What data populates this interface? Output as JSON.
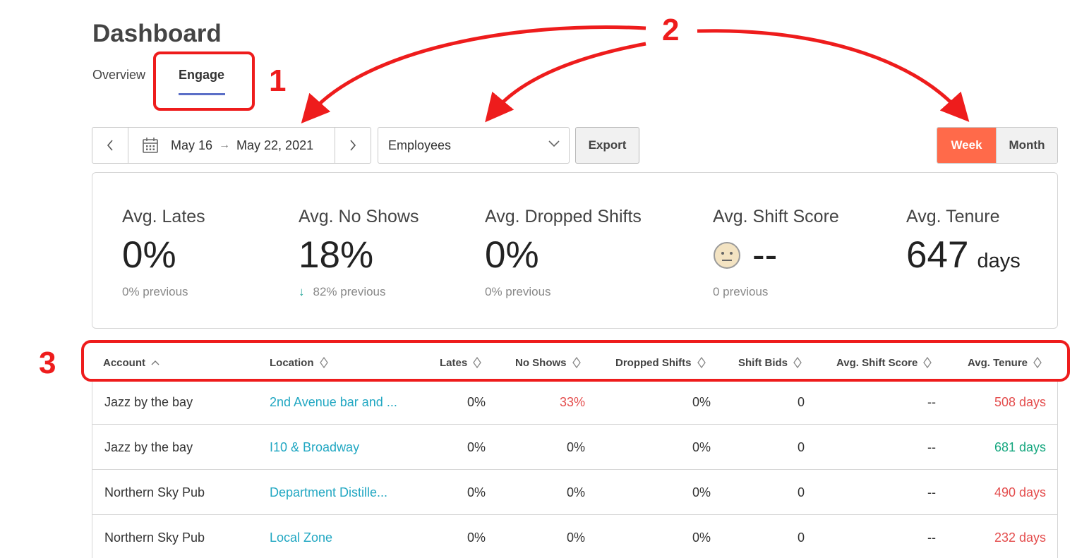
{
  "page_title": "Dashboard",
  "tabs": [
    {
      "label": "Overview",
      "active": false
    },
    {
      "label": "Engage",
      "active": true
    }
  ],
  "toolbar": {
    "date_start": "May 16",
    "date_end": "May 22, 2021",
    "group_select": "Employees",
    "export_label": "Export",
    "period_options": [
      "Week",
      "Month"
    ],
    "period_selected": "Week"
  },
  "stats": [
    {
      "label": "Avg. Lates",
      "value": "0%",
      "previous": "0% previous"
    },
    {
      "label": "Avg. No Shows",
      "value": "18%",
      "previous": "82% previous",
      "trend": "down"
    },
    {
      "label": "Avg. Dropped Shifts",
      "value": "0%",
      "previous": "0% previous"
    },
    {
      "label": "Avg. Shift Score",
      "value": "--",
      "previous": "0 previous",
      "icon": "neutral-face-icon"
    },
    {
      "label": "Avg. Tenure",
      "value": "647",
      "unit": "days"
    }
  ],
  "table": {
    "columns": [
      "Account",
      "Location",
      "Lates",
      "No Shows",
      "Dropped Shifts",
      "Shift Bids",
      "Avg. Shift Score",
      "Avg. Tenure"
    ],
    "rows": [
      {
        "account": "Jazz by the bay",
        "location": "2nd Avenue bar and ...",
        "lates": "0%",
        "no_shows": "33%",
        "dropped": "0%",
        "bids": "0",
        "score": "--",
        "tenure": "508 days",
        "no_shows_color": "red",
        "tenure_color": "red"
      },
      {
        "account": "Jazz by the bay",
        "location": "I10 & Broadway",
        "lates": "0%",
        "no_shows": "0%",
        "dropped": "0%",
        "bids": "0",
        "score": "--",
        "tenure": "681 days",
        "no_shows_color": "",
        "tenure_color": "green"
      },
      {
        "account": "Northern Sky Pub",
        "location": "Department Distille...",
        "lates": "0%",
        "no_shows": "0%",
        "dropped": "0%",
        "bids": "0",
        "score": "--",
        "tenure": "490 days",
        "no_shows_color": "",
        "tenure_color": "red"
      },
      {
        "account": "Northern Sky Pub",
        "location": "Local Zone",
        "lates": "0%",
        "no_shows": "0%",
        "dropped": "0%",
        "bids": "0",
        "score": "--",
        "tenure": "232 days",
        "no_shows_color": "",
        "tenure_color": "red"
      }
    ]
  },
  "annotations": [
    "1",
    "2",
    "3"
  ],
  "colors": {
    "accent": "#ff6a4a",
    "tab_underline": "#5b6fc7",
    "link": "#21a7c2",
    "bad": "#e44d4d",
    "good": "#16a77f",
    "annotation": "#ee1c1c"
  }
}
